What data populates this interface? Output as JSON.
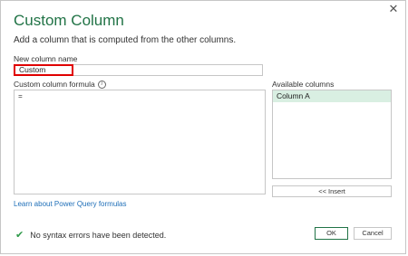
{
  "dialog": {
    "title": "Custom Column",
    "subtitle": "Add a column that is computed from the other columns.",
    "close_icon": "close-icon"
  },
  "name_field": {
    "label": "New column name",
    "value": "Custom"
  },
  "formula": {
    "label": "Custom column formula",
    "info_icon": "info-icon",
    "value": "="
  },
  "available_columns": {
    "label": "Available columns",
    "items": [
      {
        "label": "Column A"
      }
    ]
  },
  "insert_button": "<< Insert",
  "learn_link": "Learn about Power Query formulas",
  "status": {
    "icon": "check-icon",
    "text": "No syntax errors have been detected.",
    "color": "#2f9a4a"
  },
  "buttons": {
    "ok": "OK",
    "cancel": "Cancel"
  },
  "colors": {
    "title": "#217346",
    "selected_item": "#d9efe2",
    "highlight_border": "#e00000",
    "link": "#1f6fb8"
  }
}
